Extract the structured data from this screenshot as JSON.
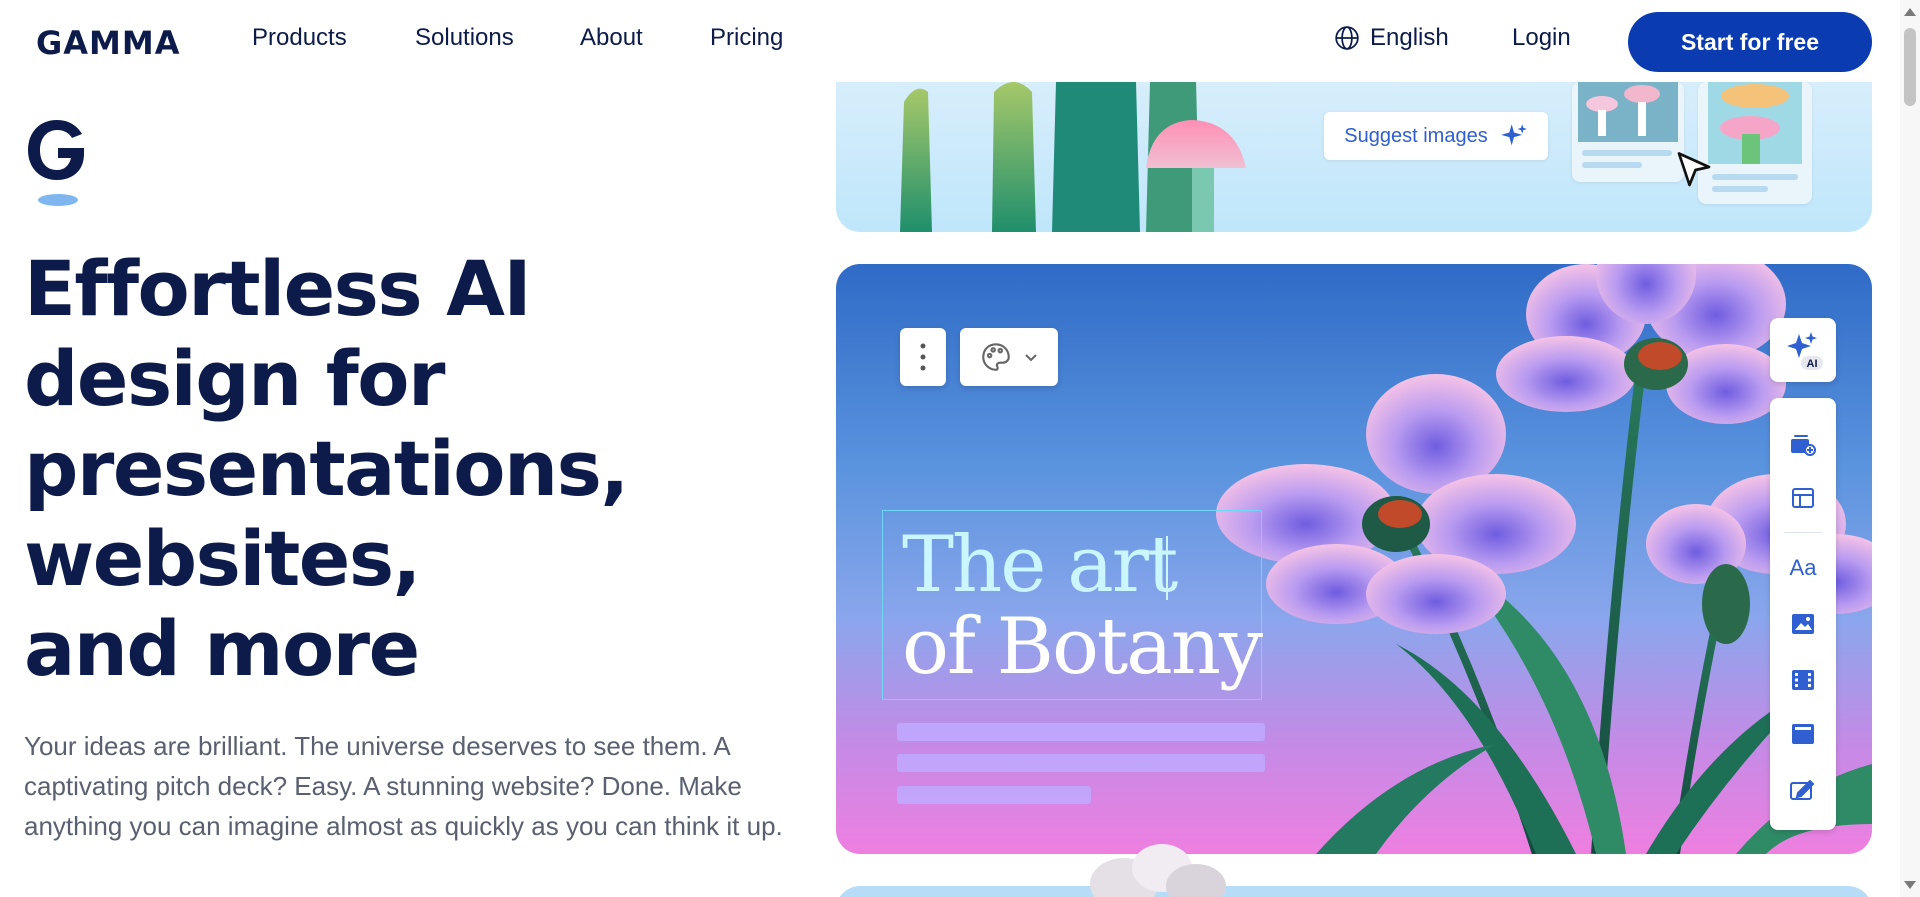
{
  "nav": {
    "logo": "GAMMA",
    "links": [
      "Products",
      "Solutions",
      "About",
      "Pricing"
    ],
    "language": "English",
    "login": "Login",
    "cta": "Start for free"
  },
  "hero": {
    "headline": [
      "Effortless AI",
      "design for",
      "presentations,",
      "websites,",
      "and more"
    ],
    "subtitle": "Your ideas are brilliant. The universe deserves to see them. A captivating pitch deck? Easy. A stunning website? Done. Make anything you can imagine almost as quickly as you can think it up."
  },
  "preview": {
    "suggest_label": "Suggest images",
    "slide_title_line1": "The art",
    "slide_title_line2": "of Botany",
    "ai_badge": "AI",
    "rail_text_tool": "Aa"
  },
  "colors": {
    "brand_navy": "#0d1b4a",
    "cta_blue": "#0a3bb0",
    "slide_top": "#2f6bc7",
    "slide_bottom": "#ee7fe0"
  },
  "icons": {
    "language": "globe-icon",
    "suggest": "sparkles-icon",
    "more": "vertical-dots-icon",
    "theme": "palette-icon",
    "ai": "sparkles-ai-icon",
    "rail": [
      "add-card-icon",
      "layout-icon",
      "text-icon",
      "image-icon",
      "video-icon",
      "embed-icon",
      "edit-icon"
    ]
  }
}
